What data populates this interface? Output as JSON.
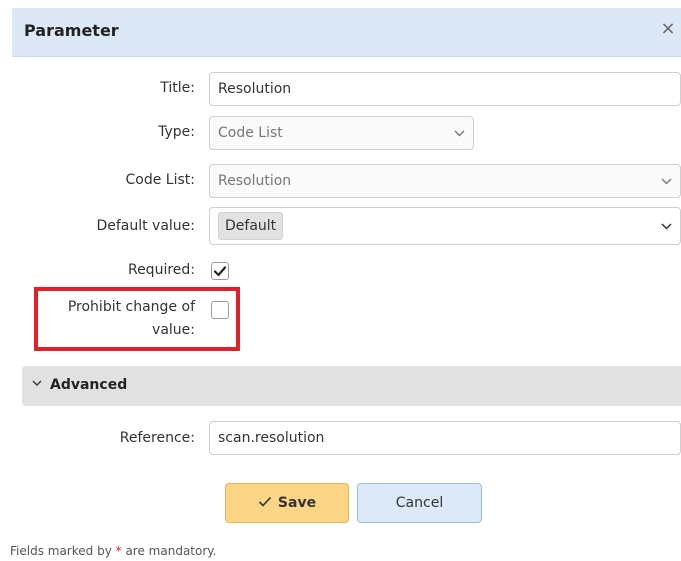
{
  "dialog": {
    "title": "Parameter",
    "close_glyph": "×"
  },
  "form": {
    "title_label": "Title:",
    "title_value": "Resolution",
    "type_label": "Type:",
    "type_value": "Code List",
    "code_list_label": "Code List:",
    "code_list_value": "Resolution",
    "default_label": "Default value:",
    "default_value": "Default",
    "required_label": "Required:",
    "required_checked": true,
    "prohibit_label_line1": "Prohibit change of",
    "prohibit_label_line2": "value:",
    "prohibit_checked": false
  },
  "advanced": {
    "title": "Advanced",
    "reference_label": "Reference:",
    "reference_value": "scan.resolution"
  },
  "buttons": {
    "save_label": "Save",
    "cancel_label": "Cancel"
  },
  "footer": {
    "note_prefix": "Fields marked by",
    "star": "*",
    "note_suffix": "are mandatory."
  },
  "colors": {
    "header_bg": "#dce8f5",
    "highlight": "#e1202a",
    "save_bg": "#fcd587",
    "cancel_bg": "#dce9f8",
    "section_bg": "#e1e1e1"
  },
  "icons": [
    "close-icon",
    "chevron-down-icon",
    "checkmark-icon"
  ]
}
